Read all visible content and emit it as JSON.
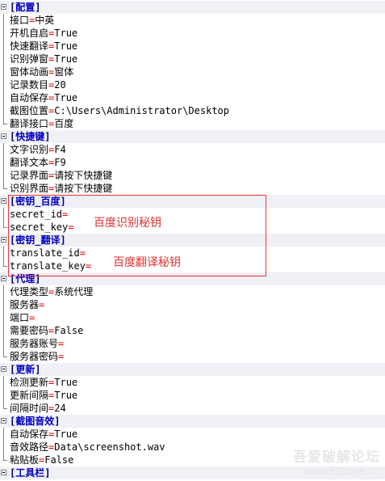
{
  "lines": [
    {
      "type": "section",
      "name": "配置"
    },
    {
      "type": "kv",
      "key": "接口",
      "value": "中英"
    },
    {
      "type": "kv",
      "key": "开机自启",
      "value": "True"
    },
    {
      "type": "kv",
      "key": "快速翻译",
      "value": "True"
    },
    {
      "type": "kv",
      "key": "识别弹窗",
      "value": "True"
    },
    {
      "type": "kv",
      "key": "窗体动画",
      "value": "窗体"
    },
    {
      "type": "kv",
      "key": "记录数目",
      "value": "20"
    },
    {
      "type": "kv",
      "key": "自动保存",
      "value": "True"
    },
    {
      "type": "kv",
      "key": "截图位置",
      "value": "C:\\Users\\Administrator\\Desktop"
    },
    {
      "type": "kv",
      "key": "翻译接口",
      "value": "百度"
    },
    {
      "type": "section",
      "name": "快捷键"
    },
    {
      "type": "kv",
      "key": "文字识别",
      "value": "F4"
    },
    {
      "type": "kv",
      "key": "翻译文本",
      "value": "F9"
    },
    {
      "type": "kv",
      "key": "记录界面",
      "value": "请按下快捷键"
    },
    {
      "type": "kv",
      "key": "识别界面",
      "value": "请按下快捷键"
    },
    {
      "type": "section",
      "name": "密钥_百度"
    },
    {
      "type": "kv",
      "key": "secret_id",
      "value": ""
    },
    {
      "type": "kv",
      "key": "secret_key",
      "value": ""
    },
    {
      "type": "section",
      "name": "密钥_翻译"
    },
    {
      "type": "kv",
      "key": "translate_id",
      "value": ""
    },
    {
      "type": "kv",
      "key": "translate_key",
      "value": ""
    },
    {
      "type": "section",
      "name": "代理"
    },
    {
      "type": "kv",
      "key": "代理类型",
      "value": "系统代理"
    },
    {
      "type": "kv",
      "key": "服务器",
      "value": ""
    },
    {
      "type": "kv",
      "key": "端口",
      "value": ""
    },
    {
      "type": "kv",
      "key": "需要密码",
      "value": "False"
    },
    {
      "type": "kv",
      "key": "服务器账号",
      "value": ""
    },
    {
      "type": "kv",
      "key": "服务器密码",
      "value": ""
    },
    {
      "type": "section",
      "name": "更新"
    },
    {
      "type": "kv",
      "key": "检测更新",
      "value": "True"
    },
    {
      "type": "kv",
      "key": "更新间隔",
      "value": "True"
    },
    {
      "type": "kv",
      "key": "间隔时间",
      "value": "24"
    },
    {
      "type": "section",
      "name": "截图音效"
    },
    {
      "type": "kv",
      "key": "自动保存",
      "value": "True"
    },
    {
      "type": "kv",
      "key": "音效路径",
      "value": "Data\\screenshot.wav"
    },
    {
      "type": "kv",
      "key": "粘贴板",
      "value": "False"
    },
    {
      "type": "section",
      "name": "工具栏"
    }
  ],
  "symbols": {
    "open_bracket": "[",
    "close_bracket": "]",
    "equals": "="
  },
  "annotations": {
    "baidu_ocr_key": "百度识别秘钥",
    "baidu_translate_key": "百度翻译秘钥"
  },
  "watermark": {
    "title": "吾爱破解论坛",
    "url": "www.52pojie.cn"
  },
  "colors": {
    "section_bg": "#f0f0f7",
    "equals": "#e00000",
    "section_name": "#0000c0",
    "annotation": "#e53030"
  }
}
